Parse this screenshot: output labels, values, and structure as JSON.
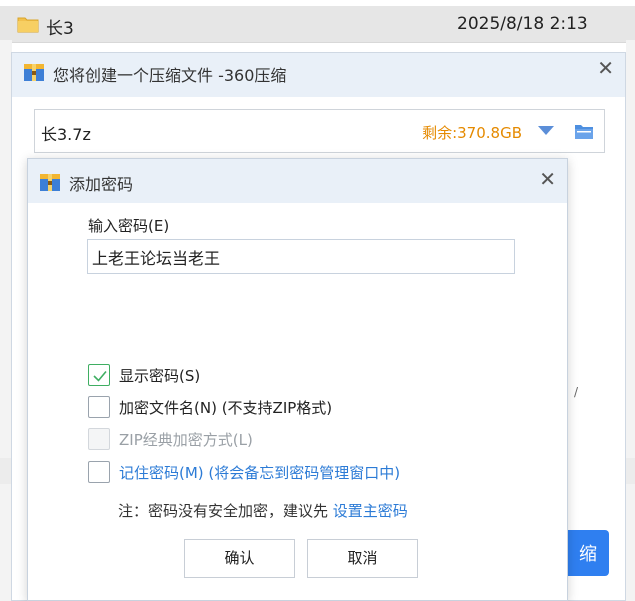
{
  "file_list": {
    "row": {
      "name": "长3",
      "date": "2025/8/18 2:13",
      "icon": "folder-icon"
    }
  },
  "main_dialog": {
    "title": "您将创建一个压缩文件 -360压缩",
    "app_icon": "archive-app-icon",
    "close_icon": "✕",
    "path": {
      "value": "长3.7z",
      "free_space": "剩余:370.8GB"
    },
    "compress_button_partial": "缩",
    "edge_glyph": "/"
  },
  "password_dialog": {
    "title": "添加密码",
    "close_icon": "✕",
    "input_label": "输入密码(E)",
    "password_value": "上老王论坛当老王",
    "options": {
      "show_password": {
        "label": "显示密码(S)",
        "checked": true
      },
      "encrypt_filenames": {
        "label": "加密文件名(N) (不支持ZIP格式)",
        "checked": false
      },
      "zip_classic": {
        "label": "ZIP经典加密方式(L)",
        "checked": false,
        "disabled": true
      },
      "remember_password": {
        "label": "记住密码(M) (将会备忘到密码管理窗口中)",
        "checked": false
      }
    },
    "note": {
      "text": "注：密码没有安全加密，建议先 ",
      "link": "设置主密码"
    },
    "buttons": {
      "ok": "确认",
      "cancel": "取消"
    }
  },
  "colors": {
    "accent_blue": "#2f7ff0",
    "link_blue": "#2c7bd6",
    "free_space_orange": "#e58a00",
    "check_green": "#3fae62",
    "title_bar_bg": "#e9f0f8"
  }
}
